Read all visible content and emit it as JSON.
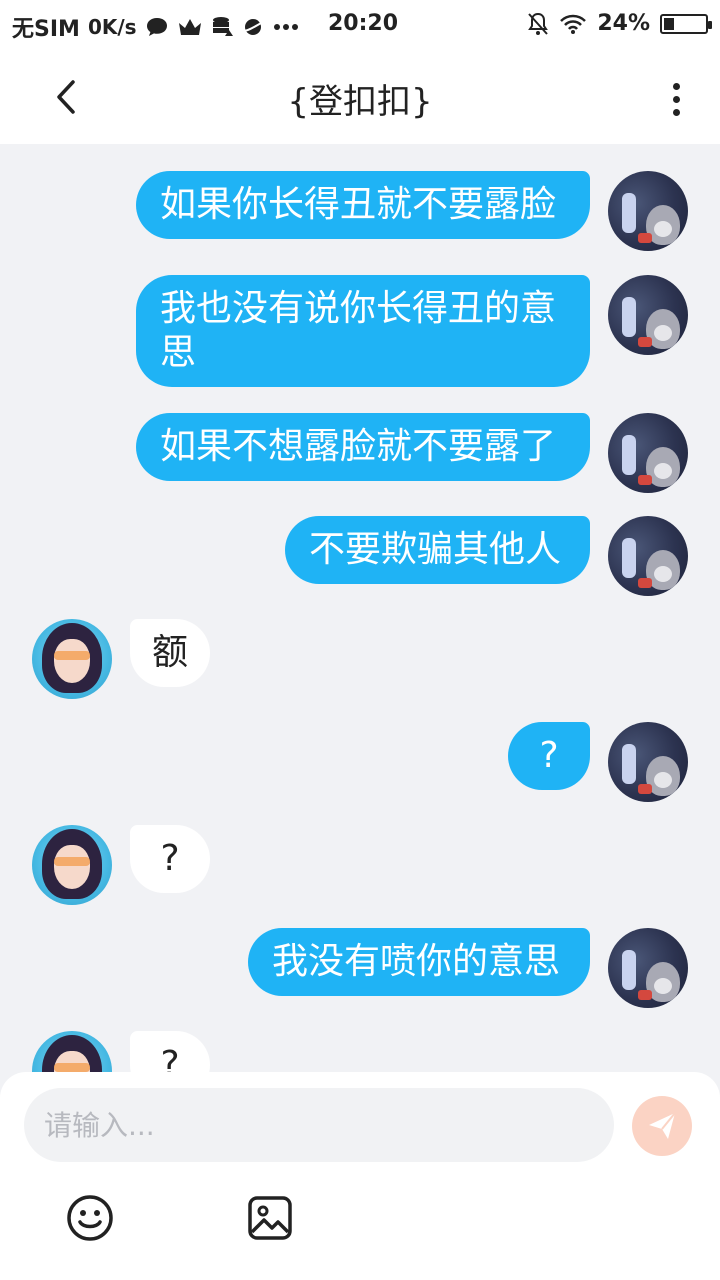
{
  "statusbar": {
    "sim": "无SIM",
    "speed": "0K/s",
    "time": "20:20",
    "battery": "24%",
    "battery_level": 0.24,
    "icons": [
      "chat-bubble-icon",
      "crown-icon",
      "database-icon",
      "planet-icon",
      "more-dots-icon",
      "mute-bell-icon",
      "wifi-icon",
      "battery-icon"
    ]
  },
  "header": {
    "title": "{登扣扣}",
    "back_icon": "chevron-left-icon",
    "more_icon": "vertical-dots-icon"
  },
  "messages": [
    {
      "from": "me",
      "text": "如果你长得丑就不要露脸"
    },
    {
      "from": "me",
      "text": "我也没有说你长得丑的意思"
    },
    {
      "from": "me",
      "text": "如果不想露脸就不要露了"
    },
    {
      "from": "me",
      "text": "不要欺骗其他人"
    },
    {
      "from": "them",
      "text": "额"
    },
    {
      "from": "me",
      "text": "?"
    },
    {
      "from": "them",
      "text": "?"
    },
    {
      "from": "me",
      "text": "我没有喷你的意思"
    },
    {
      "from": "them",
      "text": "?"
    }
  ],
  "composer": {
    "placeholder": "请输入...",
    "value": "",
    "send_icon": "paper-plane-icon",
    "emoji_icon": "smiley-icon",
    "image_icon": "image-icon"
  },
  "colors": {
    "my_bubble": "#1fb3f5",
    "their_bubble": "#ffffff",
    "background": "#f1f2f5",
    "send_button": "#fbd3c4"
  }
}
